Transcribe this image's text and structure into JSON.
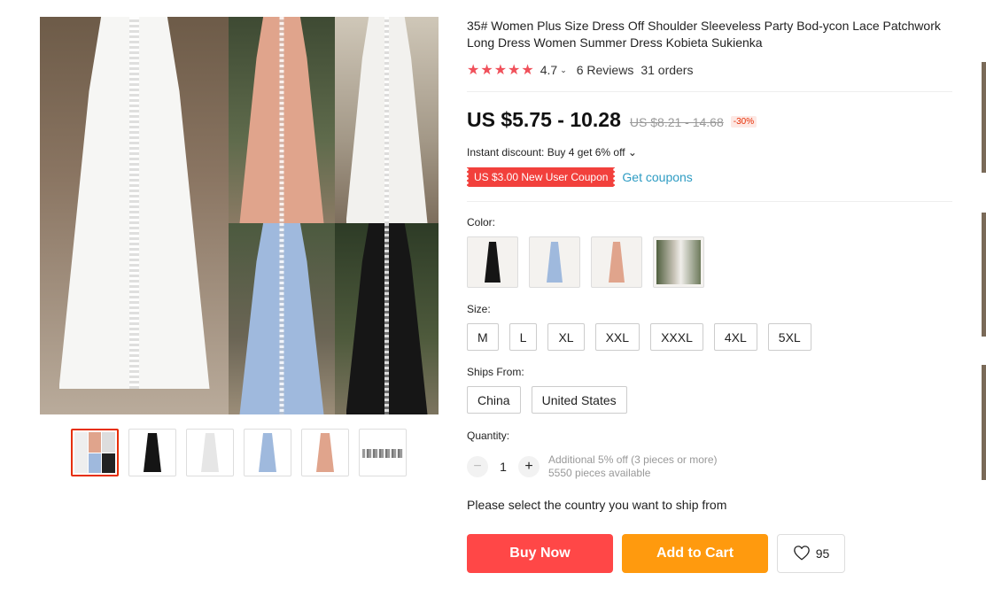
{
  "product": {
    "title": "35# Women Plus Size Dress Off Shoulder Sleeveless Party Bod-ycon Lace Patchwork Long Dress Women Summer Dress Kobieta Sukienka",
    "rating": {
      "stars": "★★★★★",
      "value": "4.7",
      "chevron": "⌄",
      "reviews": "6 Reviews",
      "orders": "31 orders"
    },
    "price": {
      "current": "US $5.75 - 10.28",
      "original": "US $8.21 - 14.68",
      "discount": "-30%"
    },
    "instant_discount": "Instant discount: Buy 4 get 6% off ⌄",
    "coupon": {
      "label": "US $3.00 New User Coupon",
      "link": "Get coupons"
    }
  },
  "gallery": {
    "thumbnails": [
      {
        "name": "collage",
        "selected": true
      },
      {
        "name": "black"
      },
      {
        "name": "white"
      },
      {
        "name": "blue"
      },
      {
        "name": "pink"
      },
      {
        "name": "strip"
      }
    ]
  },
  "options": {
    "color_label": "Color:",
    "colors": [
      "black",
      "blue",
      "pink",
      "photo"
    ],
    "size_label": "Size:",
    "sizes": [
      "M",
      "L",
      "XL",
      "XXL",
      "XXXL",
      "4XL",
      "5XL"
    ],
    "ships_label": "Ships From:",
    "ships": [
      "China",
      "United States"
    ]
  },
  "quantity": {
    "label": "Quantity:",
    "minus": "−",
    "plus": "+",
    "value": "1",
    "extra_discount": "Additional 5% off (3 pieces or more)",
    "available": "5550 pieces available"
  },
  "ship_note": "Please select the country you want to ship from",
  "actions": {
    "buy_now": "Buy Now",
    "add_to_cart": "Add to Cart",
    "wishlist_count": "95"
  },
  "colors": {
    "accent_red": "#ff4747",
    "accent_orange": "#ff9a0e",
    "star_red": "#f0505a",
    "link_blue": "#2e9cc3"
  }
}
